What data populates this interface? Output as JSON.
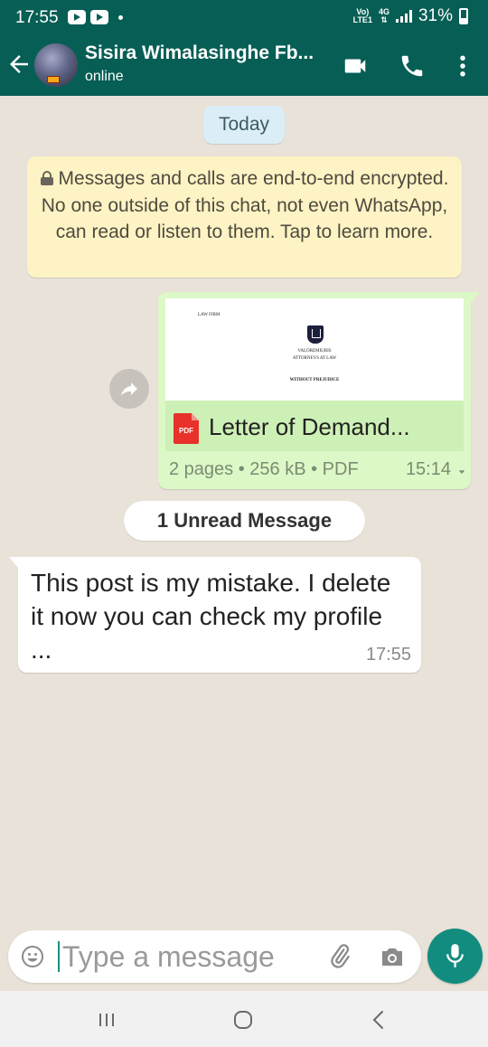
{
  "status_bar": {
    "time": "17:55",
    "network_top": "Vo)",
    "network_bottom": "LTE1",
    "network_type": "4G",
    "battery": "31%"
  },
  "header": {
    "contact_name": "Sisira Wimalasinghe Fb...",
    "contact_status": "online",
    "icons": [
      "back-arrow-icon",
      "video-call-icon",
      "voice-call-icon",
      "more-options-icon"
    ]
  },
  "chat": {
    "date_label": "Today",
    "encryption_notice": "Messages and calls are end-to-end encrypted. No one outside of this chat, not even WhatsApp, can read or listen to them. Tap to learn more.",
    "document_message": {
      "preview": {
        "firm_small": "LAW FIRM",
        "firm_name": "VALOREMIURIS",
        "firm_subtitle": "ATTORNEYS AT LAW",
        "heading": "WITHOUT PREJUDICE"
      },
      "file_type_badge": "PDF",
      "file_name": "Letter of Demand...",
      "meta": "2 pages • 256 kB • PDF",
      "time": "15:14"
    },
    "unread_divider": "1 Unread Message",
    "incoming_message": {
      "text": "This post is my mistake. I delete it now you can check my profile ...",
      "time": "17:55"
    }
  },
  "composer": {
    "placeholder": "Type a message"
  },
  "colors": {
    "header": "#075e54",
    "outgoing_bubble": "#dcf8c6",
    "incoming_bubble": "#ffffff",
    "notice": "#fdf3c4",
    "date_pill": "#dbeef7",
    "mic_button": "#128c7e"
  }
}
